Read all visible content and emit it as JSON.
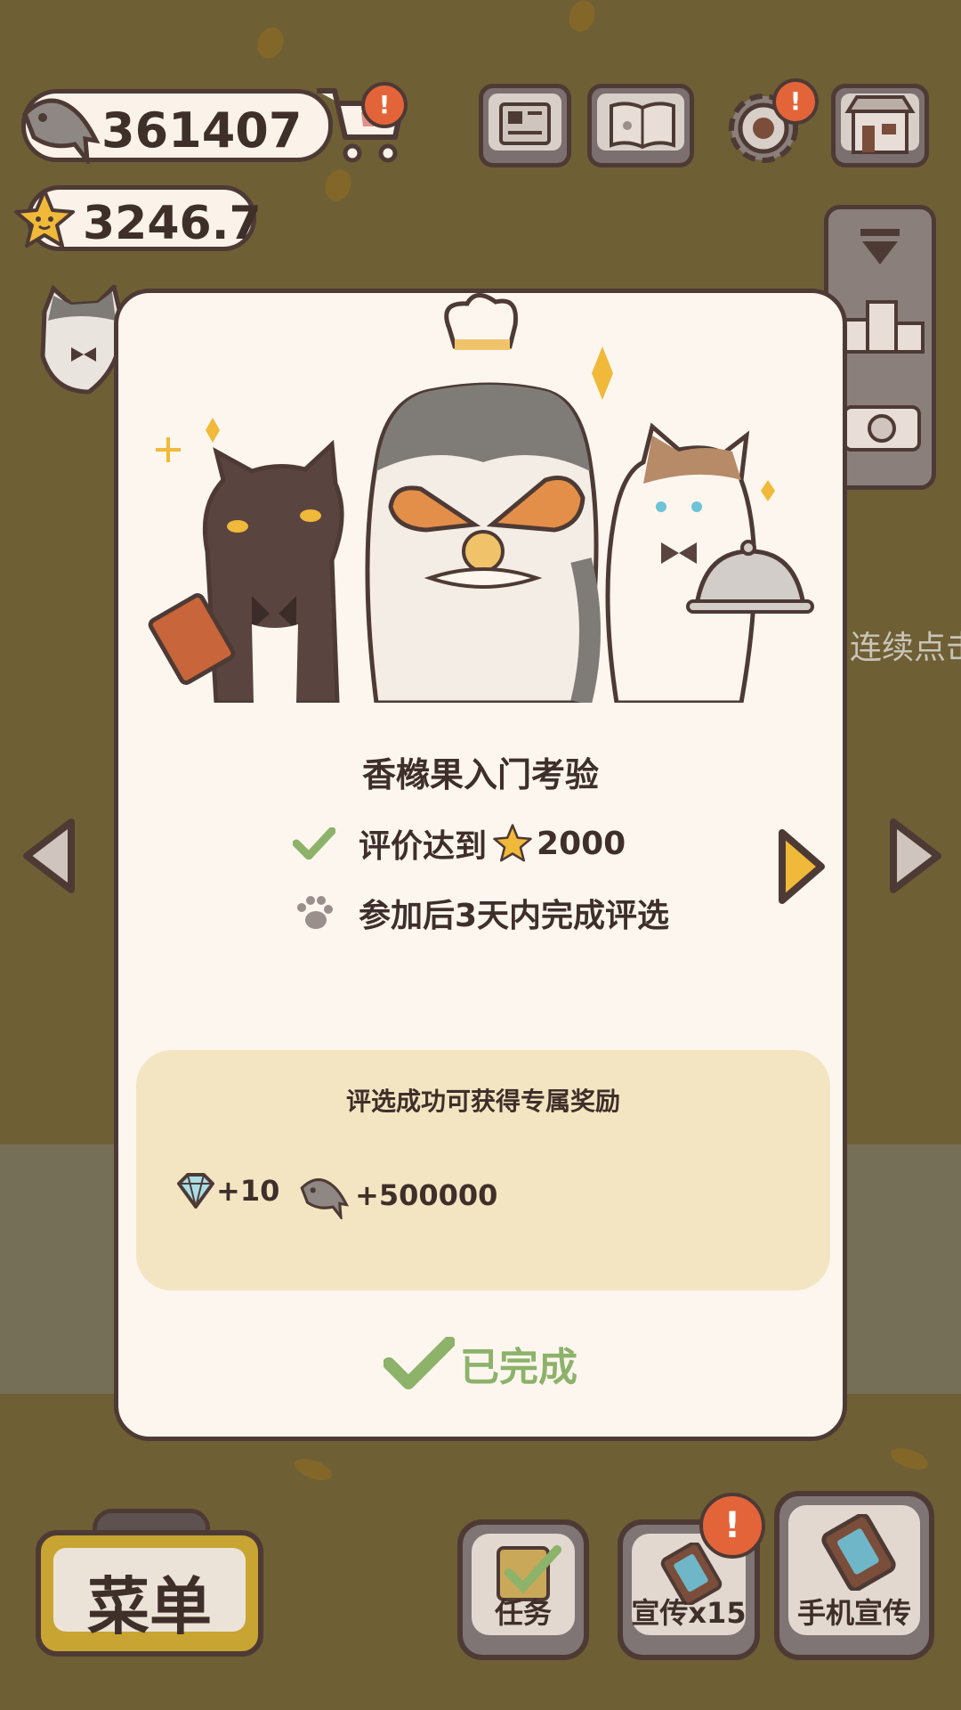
{
  "hud": {
    "fish_count": "361407",
    "rating": "3246.7"
  },
  "top_buttons": [
    "newspaper-icon",
    "recipe-book-icon",
    "settings-icon",
    "shop-icon"
  ],
  "quest": {
    "title": "香橼果入门考验",
    "requirement_rating_label": "评价达到",
    "requirement_rating_value": "2000",
    "requirement_time": "参加后3天内完成评选",
    "reward_title": "评选成功可获得专属奖励",
    "reward_gems": "+10",
    "reward_fish": "+500000",
    "status": "已完成"
  },
  "hint": "连续点击",
  "bottom": {
    "menu_label": "菜单",
    "tasks_label": "任务",
    "promo_label": "宣传x15",
    "phone_promo_label": "手机宣传",
    "alert_mark": "!"
  },
  "colors": {
    "accent_gold": "#f0b93a",
    "done_green": "#8db26a",
    "alert_orange": "#e4643a",
    "outline": "#4e3a35"
  }
}
